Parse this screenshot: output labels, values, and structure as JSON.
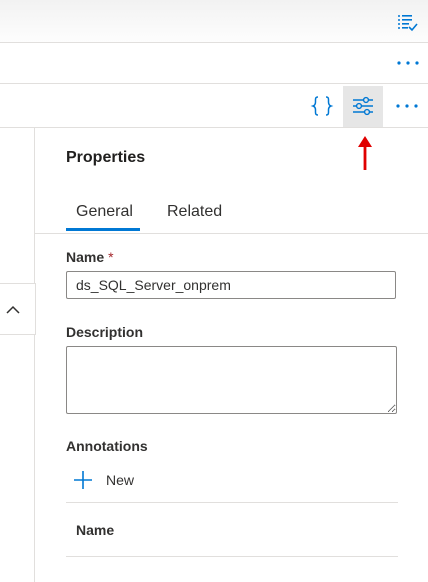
{
  "colors": {
    "accent": "#0078d4",
    "annotation_arrow": "#e00000",
    "required_marker": "#a4262c",
    "selected_button_bg": "#e6e6e6"
  },
  "toolbar": {
    "top_right_icon": "list-check-icon",
    "overflow_icon": "more-horizontal-icon",
    "code_icon": "braces-icon",
    "properties_icon": "properties-sliders-icon"
  },
  "properties": {
    "title": "Properties",
    "tabs": [
      {
        "label": "General",
        "selected": true
      },
      {
        "label": "Related",
        "selected": false
      }
    ],
    "name": {
      "label": "Name",
      "required_marker": "*",
      "value": "ds_SQL_Server_onprem"
    },
    "description": {
      "label": "Description",
      "value": ""
    },
    "annotations": {
      "label": "Annotations",
      "new_label": "New",
      "columns": [
        "Name"
      ]
    }
  }
}
